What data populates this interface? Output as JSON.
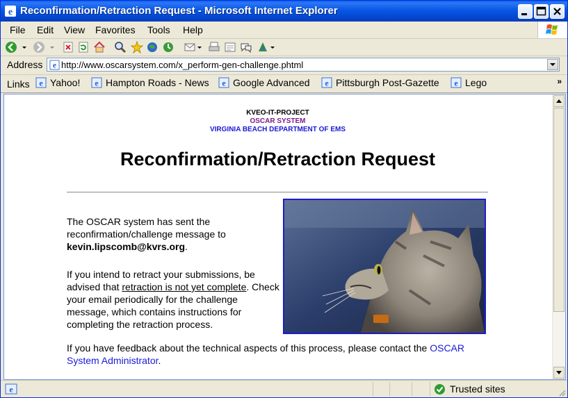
{
  "window": {
    "title": "Reconfirmation/Retraction Request - Microsoft Internet Explorer",
    "accent": "#0a5ff1"
  },
  "menu": {
    "items": [
      {
        "label": "File"
      },
      {
        "label": "Edit"
      },
      {
        "label": "View"
      },
      {
        "label": "Favorites"
      },
      {
        "label": "Tools"
      },
      {
        "label": "Help"
      }
    ]
  },
  "toolbar": {
    "icons": [
      "back-icon",
      "forward-icon",
      "stop-icon",
      "refresh-icon",
      "home-icon",
      "search-icon",
      "favorites-icon",
      "media-icon",
      "history-icon",
      "mail-icon",
      "print-icon",
      "edit-icon",
      "discuss-icon",
      "messenger-icon"
    ]
  },
  "address": {
    "label": "Address",
    "url": "http://www.oscarsystem.com/x_perform-gen-challenge.phtml"
  },
  "links": {
    "label": "Links",
    "more": "»",
    "items": [
      {
        "label": "Yahoo!"
      },
      {
        "label": "Hampton Roads - News"
      },
      {
        "label": "Google Advanced"
      },
      {
        "label": "Pittsburgh Post-Gazette"
      },
      {
        "label": "Lego"
      }
    ]
  },
  "page": {
    "header_line1": "KVEO-IT-PROJECT",
    "header_line2": "OSCAR SYSTEM",
    "header_line3": "VIRGINIA BEACH DEPARTMENT OF EMS",
    "header_color2": "#7b1a8c",
    "header_color3": "#1a1ad4",
    "title": "Reconfirmation/Retraction Request",
    "para1_text": "The OSCAR system has sent the reconfirmation/challenge message to",
    "para1_email": "kevin.lipscomb@kvrs.org",
    "para1_end": ".",
    "para2_a": "If you intend to retract your submissions, be advised that",
    "para2_underlined": "retraction is not yet complete",
    "para2_b": ". Check your email periodically for the challenge message, which contains instructions for completing the retraction process.",
    "feedback_text": "If you have feedback about the technical aspects of this process, please contact the",
    "feedback_link": "OSCAR System Administrator",
    "feedback_end": ".",
    "photo_icon": "cat-photo"
  },
  "status": {
    "zone": "Trusted sites"
  }
}
